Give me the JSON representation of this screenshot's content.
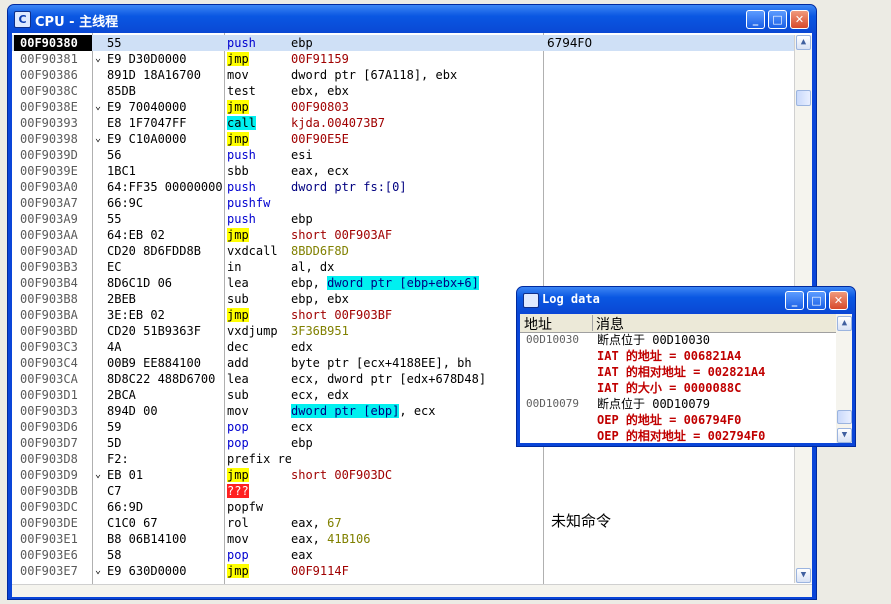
{
  "cpu_window": {
    "title": "CPU - 主线程",
    "icon_letter": "C",
    "buttons": {
      "minimize": "_",
      "maximize": "□",
      "close": "✕"
    }
  },
  "disasm": {
    "rows": [
      {
        "addr": "00F90380",
        "jm": "",
        "hex": "55",
        "mn": "push",
        "mn_style": "blue",
        "op": "ebp",
        "op_style": "",
        "comment": "6794F0",
        "selected": true
      },
      {
        "addr": "00F90381",
        "jm": "⌄",
        "hex": "E9 D30D0000",
        "mn": "jmp",
        "mn_style": "yellow",
        "op": "00F91159",
        "op_style": "red",
        "comment": ""
      },
      {
        "addr": "00F90386",
        "jm": "",
        "hex": "891D 18A16700",
        "mn": "mov",
        "mn_style": "",
        "op": "dword ptr [67A118], ebx",
        "op_style": "",
        "comment": ""
      },
      {
        "addr": "00F9038C",
        "jm": "",
        "hex": "85DB",
        "mn": "test",
        "mn_style": "",
        "op": "ebx, ebx",
        "op_style": "",
        "comment": ""
      },
      {
        "addr": "00F9038E",
        "jm": "⌄",
        "hex": "E9 70040000",
        "mn": "jmp",
        "mn_style": "yellow",
        "op": "00F90803",
        "op_style": "red",
        "comment": ""
      },
      {
        "addr": "00F90393",
        "jm": "",
        "hex": "E8 1F7047FF",
        "mn": "call",
        "mn_style": "cyan",
        "op": "kjda.004073B7",
        "op_style": "red",
        "comment": ""
      },
      {
        "addr": "00F90398",
        "jm": "⌄",
        "hex": "E9 C10A0000",
        "mn": "jmp",
        "mn_style": "yellow",
        "op": "00F90E5E",
        "op_style": "red",
        "comment": ""
      },
      {
        "addr": "00F9039D",
        "jm": "",
        "hex": "56",
        "mn": "push",
        "mn_style": "blue",
        "op": "esi",
        "op_style": "",
        "comment": ""
      },
      {
        "addr": "00F9039E",
        "jm": "",
        "hex": "1BC1",
        "mn": "sbb",
        "mn_style": "",
        "op": "eax, ecx",
        "op_style": "",
        "comment": ""
      },
      {
        "addr": "00F903A0",
        "jm": "",
        "hex": "64:FF35 00000000",
        "mn": "push",
        "mn_style": "blue",
        "op": "dword ptr fs:[0]",
        "op_style": "navy",
        "comment": ""
      },
      {
        "addr": "00F903A7",
        "jm": "",
        "hex": "66:9C",
        "mn": "pushfw",
        "mn_style": "blue",
        "op": "",
        "op_style": "",
        "comment": ""
      },
      {
        "addr": "00F903A9",
        "jm": "",
        "hex": "55",
        "mn": "push",
        "mn_style": "blue",
        "op": "ebp",
        "op_style": "",
        "comment": ""
      },
      {
        "addr": "00F903AA",
        "jm": "",
        "hex": "64:EB 02",
        "mn": "jmp",
        "mn_style": "yellow",
        "op": "short 00F903AF",
        "op_style": "red",
        "comment": ""
      },
      {
        "addr": "00F903AD",
        "jm": "",
        "hex": "CD20 8D6FDD8B",
        "mn": "vxdcall",
        "mn_style": "",
        "op": "8BDD6F8D",
        "op_style": "olive",
        "comment": ""
      },
      {
        "addr": "00F903B3",
        "jm": "",
        "hex": "EC",
        "mn": "in",
        "mn_style": "",
        "op": "al, dx",
        "op_style": "",
        "comment": ""
      },
      {
        "addr": "00F903B4",
        "jm": "",
        "hex": "8D6C1D 06",
        "mn": "lea",
        "mn_style": "",
        "op_pre": "ebp, ",
        "op": "dword ptr [ebp+ebx+6]",
        "op_style": "hlcyan",
        "comment": ""
      },
      {
        "addr": "00F903B8",
        "jm": "",
        "hex": "2BEB",
        "mn": "sub",
        "mn_style": "",
        "op": "ebp, ebx",
        "op_style": "",
        "comment": ""
      },
      {
        "addr": "00F903BA",
        "jm": "",
        "hex": "3E:EB 02",
        "mn": "jmp",
        "mn_style": "yellow",
        "op": "short 00F903BF",
        "op_style": "red",
        "comment": ""
      },
      {
        "addr": "00F903BD",
        "jm": "",
        "hex": "CD20 51B9363F",
        "mn": "vxdjump",
        "mn_style": "",
        "op": "3F36B951",
        "op_style": "olive",
        "comment": ""
      },
      {
        "addr": "00F903C3",
        "jm": "",
        "hex": "4A",
        "mn": "dec",
        "mn_style": "",
        "op": "edx",
        "op_style": "",
        "comment": ""
      },
      {
        "addr": "00F903C4",
        "jm": "",
        "hex": "00B9 EE884100",
        "mn": "add",
        "mn_style": "",
        "op": "byte ptr [ecx+4188EE], bh",
        "op_style": "",
        "comment": ""
      },
      {
        "addr": "00F903CA",
        "jm": "",
        "hex": "8D8C22 488D6700",
        "mn": "lea",
        "mn_style": "",
        "op": "ecx, dword ptr [edx+678D48]",
        "op_style": "",
        "comment": ""
      },
      {
        "addr": "00F903D1",
        "jm": "",
        "hex": "2BCA",
        "mn": "sub",
        "mn_style": "",
        "op": "ecx, edx",
        "op_style": "",
        "comment": ""
      },
      {
        "addr": "00F903D3",
        "jm": "",
        "hex": "894D 00",
        "mn": "mov",
        "mn_style": "",
        "op": "dword ptr [ebp]",
        "op_post": ", ecx",
        "op_style": "hlcyan",
        "comment": ""
      },
      {
        "addr": "00F903D6",
        "jm": "",
        "hex": "59",
        "mn": "pop",
        "mn_style": "blue",
        "op": "ecx",
        "op_style": "",
        "comment": ""
      },
      {
        "addr": "00F903D7",
        "jm": "",
        "hex": "5D",
        "mn": "pop",
        "mn_style": "blue",
        "op": "ebp",
        "op_style": "",
        "comment": ""
      },
      {
        "addr": "00F903D8",
        "jm": "",
        "hex": "F2:",
        "mn": "prefix repne:",
        "mn_style": "",
        "op": "",
        "op_style": "",
        "comment": ""
      },
      {
        "addr": "00F903D9",
        "jm": "⌄",
        "hex": "EB 01",
        "mn": "jmp",
        "mn_style": "yellow",
        "op": "short 00F903DC",
        "op_style": "red",
        "comment": ""
      },
      {
        "addr": "00F903DB",
        "jm": "",
        "hex": "C7",
        "mn": "???",
        "mn_style": "red",
        "op": "",
        "op_style": "",
        "comment": ""
      },
      {
        "addr": "00F903DC",
        "jm": "",
        "hex": "66:9D",
        "mn": "popfw",
        "mn_style": "",
        "op": "",
        "op_style": "",
        "comment": ""
      },
      {
        "addr": "00F903DE",
        "jm": "",
        "hex": "C1C0 67",
        "mn": "rol",
        "mn_style": "",
        "op_pre": "eax, ",
        "op": "67",
        "op_style": "olive",
        "comment": ""
      },
      {
        "addr": "00F903E1",
        "jm": "",
        "hex": "B8 06B14100",
        "mn": "mov",
        "mn_style": "",
        "op_pre": "eax, ",
        "op": "41B106",
        "op_style": "olive",
        "comment": ""
      },
      {
        "addr": "00F903E6",
        "jm": "",
        "hex": "58",
        "mn": "pop",
        "mn_style": "blue",
        "op": "eax",
        "op_style": "",
        "comment": ""
      },
      {
        "addr": "00F903E7",
        "jm": "⌄",
        "hex": "E9 630D0000",
        "mn": "jmp",
        "mn_style": "yellow",
        "op": "00F9114F",
        "op_style": "red",
        "comment": ""
      }
    ],
    "unknown_command": "未知命令"
  },
  "log_window": {
    "title": "Log data",
    "headers": {
      "addr": "地址",
      "msg": "消息"
    },
    "rows": [
      {
        "addr": "00D10030",
        "msg": "断点位于 00D10030",
        "style": "black"
      },
      {
        "addr": "",
        "msg": "IAT 的地址 = 006821A4",
        "style": "red"
      },
      {
        "addr": "",
        "msg": "IAT 的相对地址 = 002821A4",
        "style": "red"
      },
      {
        "addr": "",
        "msg": "IAT 的大小 = 0000088C",
        "style": "red"
      },
      {
        "addr": "00D10079",
        "msg": "断点位于 00D10079",
        "style": "black"
      },
      {
        "addr": "",
        "msg": "OEP 的地址 = 006794F0",
        "style": "red"
      },
      {
        "addr": "",
        "msg": "OEP 的相对地址 = 002794F0",
        "style": "red"
      }
    ]
  },
  "colors": {
    "title_blue": "#0a48d4",
    "selected_row": "#cfe0f6",
    "jmp_highlight": "#ffff00",
    "call_highlight": "#00f0f0",
    "unknown_highlight": "#ff2020",
    "operand_red": "#a00000",
    "log_red": "#c00000"
  }
}
